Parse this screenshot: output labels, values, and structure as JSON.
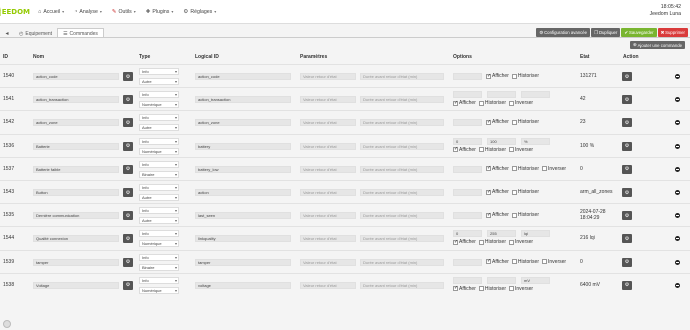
{
  "brand": {
    "logo_text": "EEDOM",
    "color": "#94ca02"
  },
  "nav": [
    {
      "icon": "home-icon",
      "label": "Accueil"
    },
    {
      "icon": "analysis-icon",
      "label": "Analyse"
    },
    {
      "icon": "wrench-icon",
      "label": "Outils"
    },
    {
      "icon": "puzzle-icon",
      "label": "Plugins"
    },
    {
      "icon": "gears-icon",
      "label": "Réglages"
    }
  ],
  "top_right": {
    "time": "18:05:42",
    "user": "Jeedom Luna"
  },
  "tabs": {
    "back": "",
    "equipement": "Equipement",
    "commandes": "Commandes"
  },
  "actions": {
    "config": "Configuration avancée",
    "duplicate": "Dupliquer",
    "save": "Sauvegarder",
    "delete": "Supprimer",
    "add_command": "Ajouter une commande"
  },
  "colors": {
    "save": "#79b530",
    "delete": "#d93b3b",
    "neutral": "#666666"
  },
  "columns": {
    "id": "ID",
    "nom": "Nom",
    "type": "Type",
    "logical": "Logical ID",
    "params": "Paramètres",
    "options": "Options",
    "etat": "Etat",
    "action": "Action"
  },
  "placeholders": {
    "state_value": "Valeur retour d'état",
    "state_duration": "Durée avant retour d'état (min)",
    "unit": "Unité",
    "min": "Min",
    "max": "Max"
  },
  "labels": {
    "afficher": "Afficher",
    "historiser": "Historiser",
    "inverser": "Inverser"
  },
  "rows": [
    {
      "id": "1540",
      "nom": "action_code",
      "type": "Info",
      "subtype": "Autre",
      "logical": "action_code",
      "min": "",
      "max": "",
      "unit": "",
      "minmax": false,
      "afficher": true,
      "historiser": false,
      "inverser": false,
      "etat": "131271"
    },
    {
      "id": "1541",
      "nom": "action_transaction",
      "type": "Info",
      "subtype": "Numérique",
      "logical": "action_transaction",
      "min": "",
      "max": "",
      "unit": "",
      "minmax": true,
      "afficher": true,
      "historiser": false,
      "inverser": false,
      "etat": "42"
    },
    {
      "id": "1542",
      "nom": "action_zone",
      "type": "Info",
      "subtype": "Autre",
      "logical": "action_zone",
      "min": "",
      "max": "",
      "unit": "",
      "minmax": false,
      "afficher": true,
      "historiser": false,
      "inverser": false,
      "etat": "23"
    },
    {
      "id": "1536",
      "nom": "Batterie",
      "type": "Info",
      "subtype": "Numérique",
      "logical": "battery",
      "min": "0",
      "max": "100",
      "unit": "%",
      "minmax": true,
      "afficher": true,
      "historiser": false,
      "inverser": false,
      "etat": "100 %"
    },
    {
      "id": "1537",
      "nom": "Batterie faible",
      "type": "Info",
      "subtype": "Binaire",
      "logical": "battery_low",
      "min": "",
      "max": "",
      "unit": "",
      "minmax": false,
      "afficher": true,
      "historiser": false,
      "inverser": false,
      "etat": "0"
    },
    {
      "id": "1543",
      "nom": "Button",
      "type": "Info",
      "subtype": "Autre",
      "logical": "action",
      "min": "",
      "max": "",
      "unit": "",
      "minmax": false,
      "afficher": true,
      "historiser": false,
      "inverser": false,
      "etat": "arm_all_zones"
    },
    {
      "id": "1535",
      "nom": "Dernière communication",
      "type": "Info",
      "subtype": "Autre",
      "logical": "last_seen",
      "min": "",
      "max": "",
      "unit": "",
      "minmax": false,
      "afficher": true,
      "historiser": false,
      "inverser": false,
      "etat": "2024-07-28 18:04:29"
    },
    {
      "id": "1544",
      "nom": "Qualité connexion",
      "type": "Info",
      "subtype": "Numérique",
      "logical": "linkquality",
      "min": "0",
      "max": "255",
      "unit": "lqi",
      "minmax": true,
      "afficher": true,
      "historiser": false,
      "inverser": false,
      "etat": "216 lqi"
    },
    {
      "id": "1539",
      "nom": "tamper",
      "type": "Info",
      "subtype": "Binaire",
      "logical": "tamper",
      "min": "",
      "max": "",
      "unit": "",
      "minmax": false,
      "afficher": true,
      "historiser": false,
      "inverser": false,
      "etat": "0"
    },
    {
      "id": "1538",
      "nom": "Voltage",
      "type": "Info",
      "subtype": "Numérique",
      "logical": "voltage",
      "min": "",
      "max": "",
      "unit": "mV",
      "minmax": true,
      "afficher": true,
      "historiser": false,
      "inverser": false,
      "etat": "6400 mV"
    }
  ]
}
